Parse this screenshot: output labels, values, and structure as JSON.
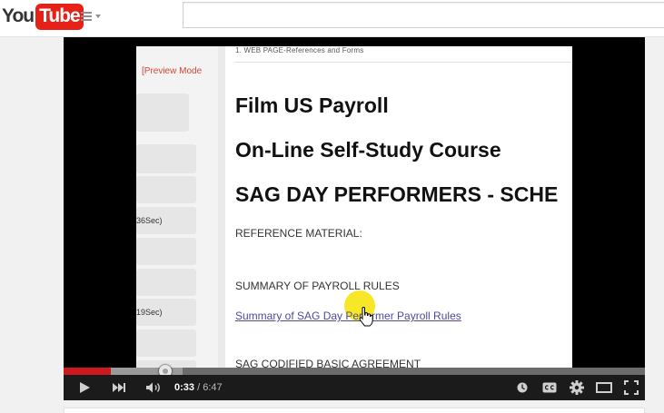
{
  "brand": {
    "you": "You",
    "tube": "Tube"
  },
  "search": {
    "placeholder": ""
  },
  "left_panel": {
    "preview_mode": "[Preview Mode",
    "item_a_duration": "36Sec)",
    "item_b_duration": "19Sec)"
  },
  "document": {
    "header": "1. WEB PAGE-References and Forms",
    "title_1": "Film US Payroll",
    "title_2": "On-Line Self-Study Course",
    "title_3": "SAG DAY PERFORMERS - SCHE",
    "reference_material": "REFERENCE MATERIAL:",
    "summary_heading": "SUMMARY OF PAYROLL RULES",
    "summary_link": "Summary of SAG Day Performer Payroll Rules",
    "agreement_heading": "SAG CODIFIED BASIC AGREEMENT"
  },
  "player": {
    "current_time": "0:33",
    "separator": " / ",
    "duration": "6:47",
    "played_fraction": 0.0811,
    "loaded_fraction": 0.205,
    "colors": {
      "played": "#cc181e",
      "loaded": "#9a9a9a",
      "track": "#6b6b6b"
    },
    "icons": [
      "play-icon",
      "next-icon",
      "volume-icon",
      "watch-later-icon",
      "captions-icon",
      "settings-icon",
      "theater-mode-icon",
      "fullscreen-icon"
    ]
  }
}
